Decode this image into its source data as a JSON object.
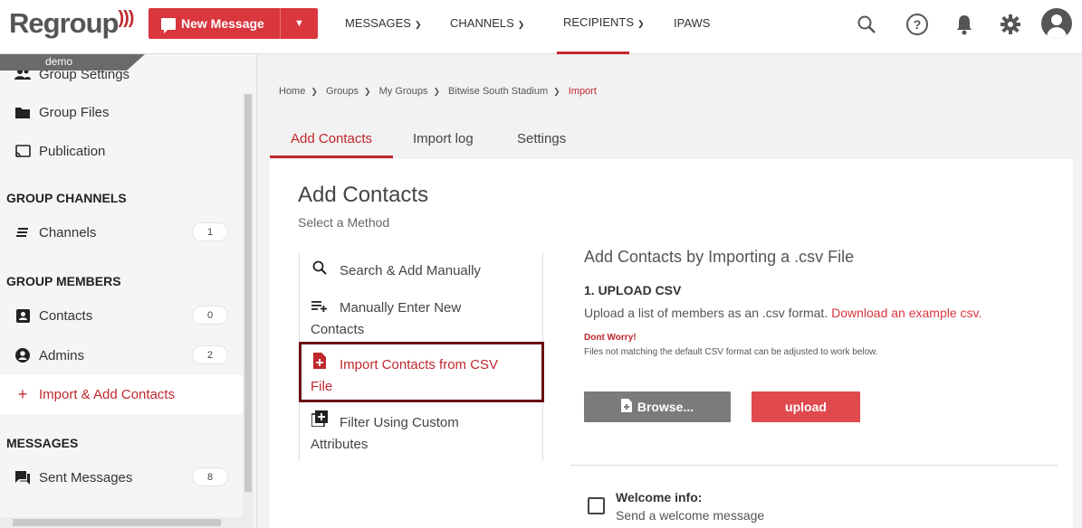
{
  "brand": {
    "name": "Regroup",
    "color": "#c0272d"
  },
  "header": {
    "new_message": "New Message",
    "nav": [
      {
        "label": "MESSAGES"
      },
      {
        "label": "CHANNELS"
      },
      {
        "label": "RECIPIENTS"
      },
      {
        "label": "IPAWS"
      }
    ],
    "active_nav": "RECIPIENTS",
    "icons": [
      "search-icon",
      "help-icon",
      "bell-icon",
      "gear-icon",
      "user-avatar-icon"
    ]
  },
  "sidebar": {
    "tag": "demo",
    "items_top": [
      {
        "label": "Group Settings",
        "icon": "people-icon"
      },
      {
        "label": "Group Files",
        "icon": "folder-icon"
      },
      {
        "label": "Publication",
        "icon": "cast-icon"
      }
    ],
    "channels_head": "GROUP CHANNELS",
    "channels": [
      {
        "label": "Channels",
        "count": "1",
        "icon": "channels-icon"
      }
    ],
    "members_head": "GROUP MEMBERS",
    "members": [
      {
        "label": "Contacts",
        "count": "0",
        "icon": "contact-card-icon"
      },
      {
        "label": "Admins",
        "count": "2",
        "icon": "admin-icon"
      },
      {
        "label": "Import & Add Contacts",
        "icon": "plus-icon"
      }
    ],
    "messages_head": "MESSAGES",
    "messages": [
      {
        "label": "Sent Messages",
        "count": "8",
        "icon": "chat-icon"
      }
    ]
  },
  "breadcrumb": [
    "Home",
    "Groups",
    "My Groups",
    "Bitwise South Stadium",
    "Import"
  ],
  "tabs": [
    "Add Contacts",
    "Import log",
    "Settings"
  ],
  "main": {
    "title": "Add Contacts",
    "subtitle": "Select a Method",
    "methods": [
      {
        "label": "Search & Add Manually",
        "icon": "search-icon"
      },
      {
        "label": "Manually Enter New Contacts",
        "icon": "list-add-icon"
      },
      {
        "label": "Import Contacts from CSV File",
        "icon": "file-plus-icon"
      },
      {
        "label": "Filter Using Custom Attributes",
        "icon": "filter-plus-icon"
      }
    ],
    "import": {
      "title": "Add Contacts by Importing a .csv File",
      "step": "1. UPLOAD CSV",
      "desc": "Upload a list of members as an .csv format.",
      "download_link": "Download an example csv.",
      "warn": "Dont Worry!",
      "note": "Files not matching the default CSV format can be adjusted to work below.",
      "browse": "Browse...",
      "upload": "upload"
    },
    "welcome": {
      "title": "Welcome info:",
      "sub": "Send a welcome message"
    }
  }
}
